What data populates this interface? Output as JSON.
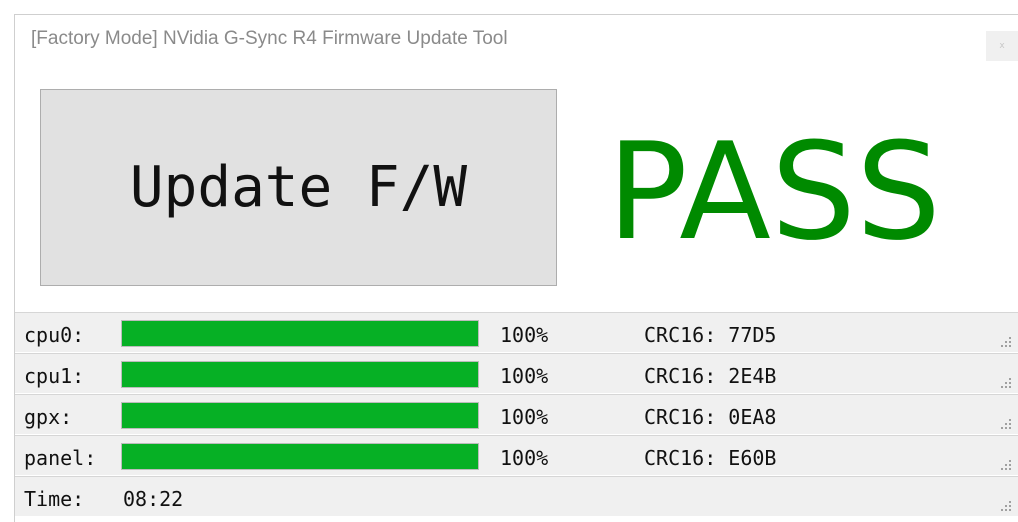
{
  "window": {
    "title": "[Factory Mode] NVidia G-Sync R4 Firmware Update Tool",
    "close_glyph": "x"
  },
  "main": {
    "update_button_label": "Update F/W",
    "status": "PASS",
    "status_color": "#008a00"
  },
  "progress_rows": [
    {
      "label": "cpu0:",
      "progress": 1.0,
      "percent": "100%",
      "crc": "CRC16: 77D5"
    },
    {
      "label": "cpu1:",
      "progress": 1.0,
      "percent": "100%",
      "crc": "CRC16: 2E4B"
    },
    {
      "label": "gpx:",
      "progress": 1.0,
      "percent": "100%",
      "crc": "CRC16: 0EA8"
    },
    {
      "label": "panel:",
      "progress": 1.0,
      "percent": "100%",
      "crc": "CRC16: E60B"
    }
  ],
  "time_row": {
    "label": "Time:",
    "value": "08:22"
  },
  "colors": {
    "progress_fill": "#06b025",
    "button_bg": "#e1e1e1",
    "statusbar_bg": "#f0f0f0"
  },
  "icons": {
    "resize_grip": "size-grip-icon"
  }
}
